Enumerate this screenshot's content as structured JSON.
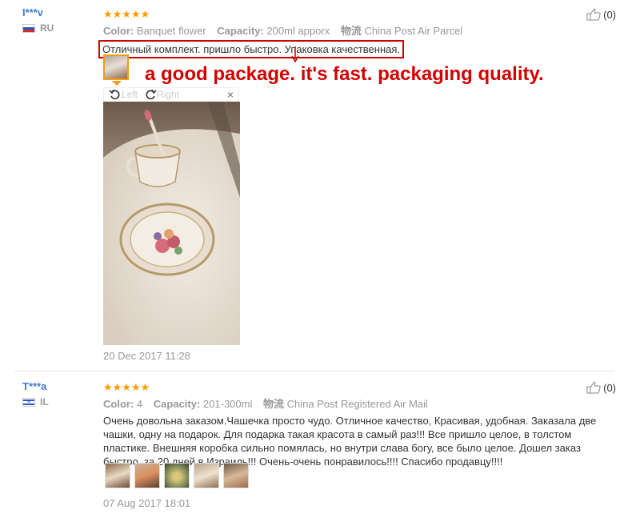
{
  "reviews": [
    {
      "user": "I***v",
      "country": "RU",
      "stars": "★★★★★",
      "meta": {
        "color_label": "Color:",
        "color_value": "Banquet flower",
        "capacity_label": "Capacity:",
        "capacity_value": "200ml apporx",
        "ship_label": "物流",
        "ship_value": "China Post Air Parcel"
      },
      "text": "Отличный комплект. пришло быстро. Упаковка качественная.",
      "annotation": "a good package. it's fast. packaging quality.",
      "viewer": {
        "left_label": "Left",
        "right_label": "Right",
        "close": "×"
      },
      "likes": "(0)",
      "date": "20 Dec 2017 11:28"
    },
    {
      "user": "T***a",
      "country": "IL",
      "stars": "★★★★★",
      "meta": {
        "color_label": "Color:",
        "color_value": "4",
        "capacity_label": "Capacity:",
        "capacity_value": "201-300ml",
        "ship_label": "物流",
        "ship_value": "China Post Registered Air Mail"
      },
      "text": "Очень довольна заказом.Чашечка просто чудо. Отличное качество, Красивая, удобная. Заказала две чашки, одну на подарок. Для подарка такая красота в самый раз!!! Все пришло целое, в толстом пластике. Внешняя коробка сильно помялась, но внутри слава богу, все было целое. Дошел заказ быстро, за 20 дней в Израиль!!! Очень-очень понравилось!!!! Спасибо продавцу!!!!",
      "likes": "(0)",
      "date": "07 Aug 2017 18:01"
    }
  ],
  "colors": {
    "username": "#3d7ad6",
    "stars": "#ff9a00",
    "annotation": "#d40000",
    "highlight": "#cc0000"
  },
  "icons": [
    "thumbs-up-icon",
    "rotate-left-icon",
    "rotate-right-icon",
    "close-icon",
    "down-arrow-icon",
    "flag-icon"
  ]
}
